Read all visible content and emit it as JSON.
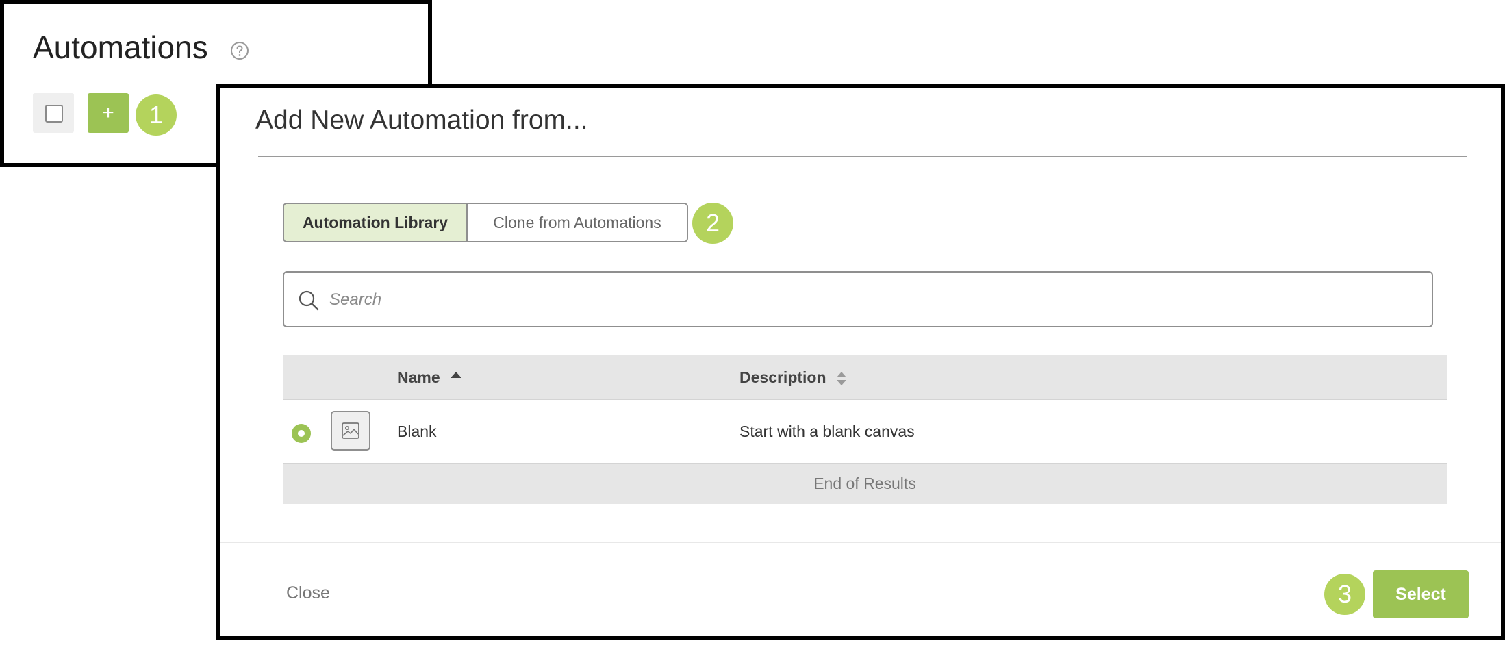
{
  "automations_panel": {
    "title": "Automations",
    "add_button_label": "+"
  },
  "modal": {
    "title": "Add New Automation from...",
    "tabs": [
      {
        "label": "Automation Library",
        "active": true
      },
      {
        "label": "Clone from Automations",
        "active": false
      }
    ],
    "search": {
      "placeholder": "Search",
      "value": ""
    },
    "table": {
      "columns": [
        {
          "label": "Name",
          "sort": "ascending"
        },
        {
          "label": "Description",
          "sort": "none"
        }
      ],
      "rows": [
        {
          "selected": true,
          "name": "Blank",
          "description": "Start with a blank canvas"
        }
      ],
      "end_text": "End of Results"
    },
    "footer": {
      "close_label": "Close",
      "select_label": "Select"
    }
  },
  "step_badges": [
    "1",
    "2",
    "3"
  ],
  "icons": {
    "help": "help-circle-icon",
    "search": "search-icon",
    "sort_ascending": "sort-up-icon",
    "sort_both": "sort-both-icon",
    "thumbnail": "image-icon"
  },
  "colors": {
    "accent": "#9cc354",
    "badge": "#b4d35c",
    "active_tab_bg": "#e5efd3",
    "header_bg": "#e6e6e6"
  }
}
